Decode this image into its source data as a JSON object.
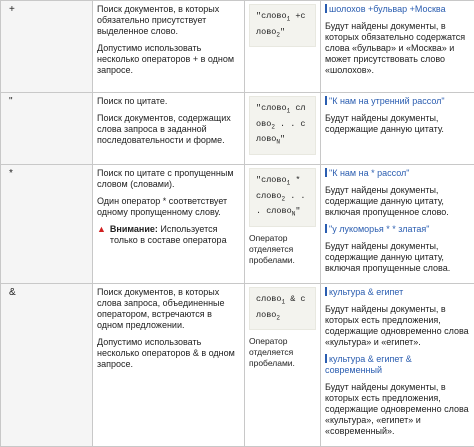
{
  "rows": [
    {
      "op": "+",
      "desc": [
        "Поиск документов, в которых обязательно присутствует выделенное слово.",
        "Допустимо использовать несколько операторов + в одном запросе."
      ],
      "example_code": [
        "\"слово1 +с",
        "лово2\""
      ],
      "example_note": "",
      "results": [
        {
          "query": "шолохов +бульвар +Москва",
          "text": "Будут найдены документы, в которых обязательно содержатся слова «бульвар» и «Москва» и может присутствовать слово «шолохов»."
        }
      ]
    },
    {
      "op": "\"",
      "desc": [
        "Поиск по цитате.",
        "Поиск документов, содержащих слова запроса в заданной последовательности и форме."
      ],
      "example_code": [
        "\"слово1 сл",
        "ово2 . . с",
        "ловоN\""
      ],
      "example_note": "",
      "results": [
        {
          "query": "\"К нам на утренний рассол\"",
          "text": "Будут найдены документы, содержащие данную цитату."
        }
      ]
    },
    {
      "op": "*",
      "desc": [
        "Поиск по цитате с пропущенным словом (словами).",
        "Один оператор * соответствует одному пропущенному слову."
      ],
      "warning_label": "Внимание:",
      "warning_text": " Используется только в составе оператора",
      "example_code": [
        "\"слово1 *",
        "слово2 . .",
        ". словоN\""
      ],
      "example_note": "Оператор отделяется пробелами.",
      "results": [
        {
          "query": "\"К нам на * рассол\"",
          "text": "Будут найдены документы, содержащие данную цитату, включая пропущенное слово."
        },
        {
          "query": "\"у лукоморья * * златая\"",
          "text": "Будут найдены документы, содержащие данную цитату, включая пропущенные слова."
        }
      ]
    },
    {
      "op": "&",
      "desc": [
        "Поиск документов, в которых слова запроса, объединенные оператором, встречаются в одном предложении.",
        "Допустимо использовать несколько операторов & в одном запросе."
      ],
      "example_code": [
        "слово1 & с",
        "лово2"
      ],
      "example_note": "Оператор отделяется пробелами.",
      "results": [
        {
          "query": "культура & египет",
          "text": "Будут найдены документы, в которых есть предложения, содержащие одновременно слова «культура» и «египет»."
        },
        {
          "query": "культура & египет & современный",
          "text": "Будут найдены документы, в которых есть предложения, содержащие одновременно слова «культура», «египет» и «современный»."
        }
      ]
    }
  ]
}
